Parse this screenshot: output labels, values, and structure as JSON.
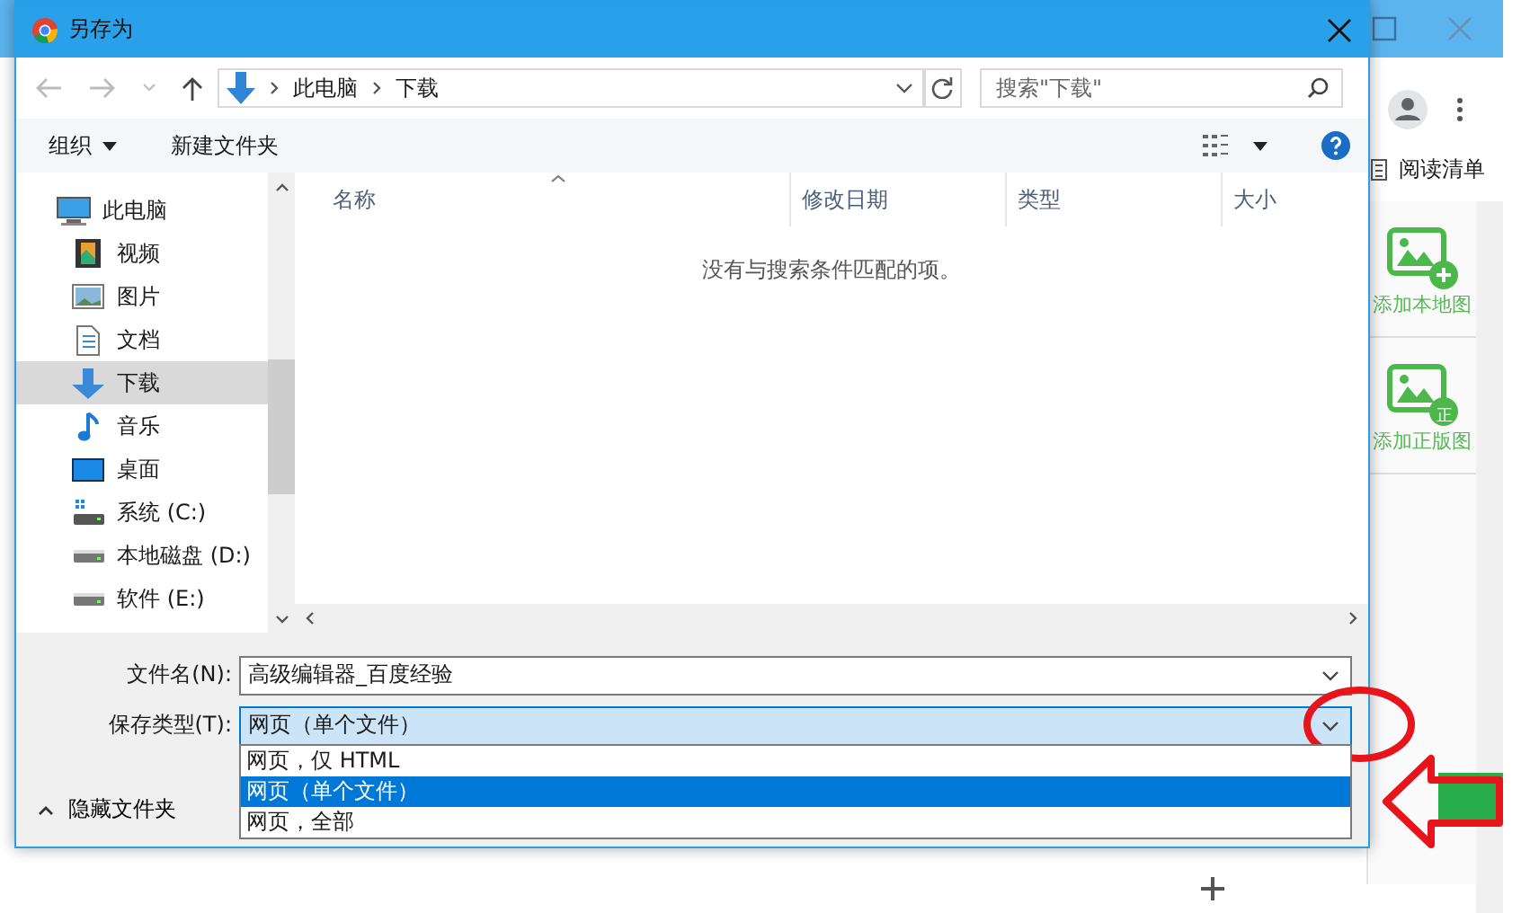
{
  "background_window": {
    "reading_list": "阅读清单",
    "panel_items": [
      {
        "label": "添加本地图",
        "kind": "add"
      },
      {
        "label": "添加正版图",
        "kind": "badge",
        "badge": "正"
      }
    ]
  },
  "dialog": {
    "title": "另存为",
    "breadcrumb": [
      "此电脑",
      "下载"
    ],
    "search": {
      "placeholder": "搜索\"下载\""
    },
    "toolbar": {
      "organize": "组织",
      "new_folder": "新建文件夹"
    },
    "nav_tree": [
      {
        "label": "此电脑",
        "kind": "computer",
        "selected": false,
        "children": [
          {
            "label": "视频",
            "kind": "video",
            "selected": false
          },
          {
            "label": "图片",
            "kind": "picture",
            "selected": false
          },
          {
            "label": "文档",
            "kind": "document",
            "selected": false
          },
          {
            "label": "下载",
            "kind": "download",
            "selected": true
          },
          {
            "label": "音乐",
            "kind": "music",
            "selected": false
          },
          {
            "label": "桌面",
            "kind": "desktop",
            "selected": false
          },
          {
            "label": "系统 (C:)",
            "kind": "system",
            "selected": false
          },
          {
            "label": "本地磁盘 (D:)",
            "kind": "drive",
            "selected": false
          },
          {
            "label": "软件 (E:)",
            "kind": "drive",
            "selected": false
          }
        ]
      }
    ],
    "columns": [
      "名称",
      "修改日期",
      "类型",
      "大小"
    ],
    "empty_message": "没有与搜索条件匹配的项。",
    "filename": {
      "label": "文件名(N):",
      "value": "高级编辑器_百度经验"
    },
    "save_type": {
      "label": "保存类型(T):",
      "value": "网页（单个文件）",
      "options": [
        {
          "label": "网页，仅 HTML",
          "selected": false
        },
        {
          "label": "网页（单个文件）",
          "selected": true
        },
        {
          "label": "网页，全部",
          "selected": false
        }
      ]
    },
    "hide_folders": "隐藏文件夹"
  }
}
